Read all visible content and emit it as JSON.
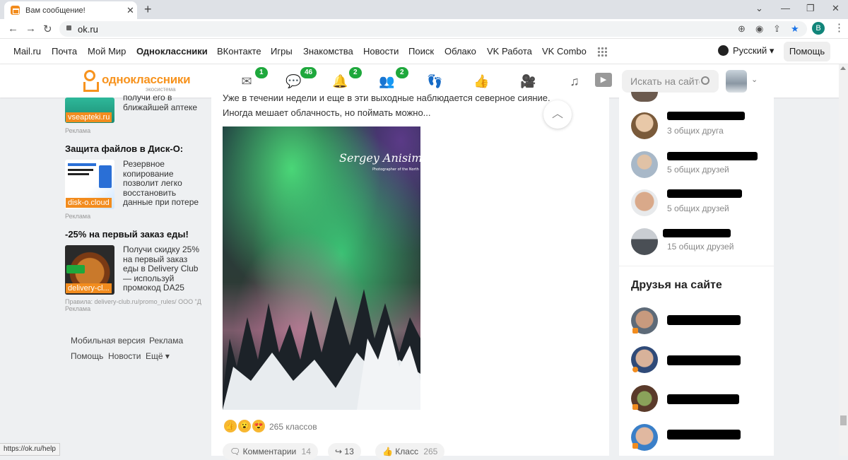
{
  "browser": {
    "tab_title": "Вам сообщение!",
    "url": "ok.ru",
    "profile_initial": "B",
    "status_url": "https://ok.ru/help"
  },
  "portal": {
    "links": [
      "Mail.ru",
      "Почта",
      "Мой Мир",
      "Одноклассники",
      "ВКонтакте",
      "Игры",
      "Знакомства",
      "Новости",
      "Поиск",
      "Облако",
      "VK Работа",
      "VK Combo"
    ],
    "active": "Одноклассники",
    "language": "Русский",
    "help": "Помощь"
  },
  "ok_header": {
    "logo_name": "одноклассники",
    "logo_sub": "экосистема",
    "nav": [
      {
        "icon": "messages-icon",
        "badge": "1"
      },
      {
        "icon": "discussions-icon",
        "badge": "46"
      },
      {
        "icon": "notifications-icon",
        "badge": "2"
      },
      {
        "icon": "friends-icon",
        "badge": "2"
      },
      {
        "icon": "guests-icon",
        "badge": ""
      },
      {
        "icon": "likes-icon",
        "badge": ""
      },
      {
        "icon": "video-icon",
        "badge": ""
      },
      {
        "icon": "music-icon",
        "badge": ""
      }
    ],
    "search_placeholder": "Искать на сайте"
  },
  "left_ads": [
    {
      "title": "",
      "text": "получи его в ближайшей аптеке",
      "label": "vseapteki.ru",
      "reklama": "Реклама"
    },
    {
      "title": "Защита файлов в Диск-О:",
      "text": "Резервное копирование позволит легко восстановить данные при потере",
      "label": "disk-o.cloud",
      "reklama": "Реклама"
    },
    {
      "title": "-25% на первый заказ еды!",
      "text": "Получи скидку 25% на первый заказ еды в Delivery Club — используй промокод DA25",
      "label": "delivery-cl...",
      "rules": "Правила: delivery-club.ru/promo_rules/ ООО \"Д",
      "reklama": "Реклама"
    }
  ],
  "left_footer": [
    "Мобильная версия",
    "Реклама",
    "Помощь",
    "Новости",
    "Ещё ▾"
  ],
  "post": {
    "text_line1": "Уже в течении недели и еще в эти выходные наблюдается северное сияние.",
    "text_line2": "Иногда мешает облачность, но поймать можно...",
    "photo_signature": "Sergey Anisimov",
    "photo_signature_sub": "Photographer of the North",
    "klass_count": "265 классов",
    "comments_label": "Комментарии",
    "comments_count": "14",
    "shares_count": "13",
    "klass_label": "Класс",
    "klass_btn_count": "265"
  },
  "right_col": {
    "possible_friends": [
      {
        "common": "3 общих друга"
      },
      {
        "common": "5 общих друзей"
      },
      {
        "common": "5 общих друзей"
      },
      {
        "common": "15 общих друзей"
      }
    ],
    "friends_title": "Друзья на сайте"
  },
  "colors": {
    "ok_orange": "#f7931e",
    "badge_green": "#1ea83c"
  }
}
